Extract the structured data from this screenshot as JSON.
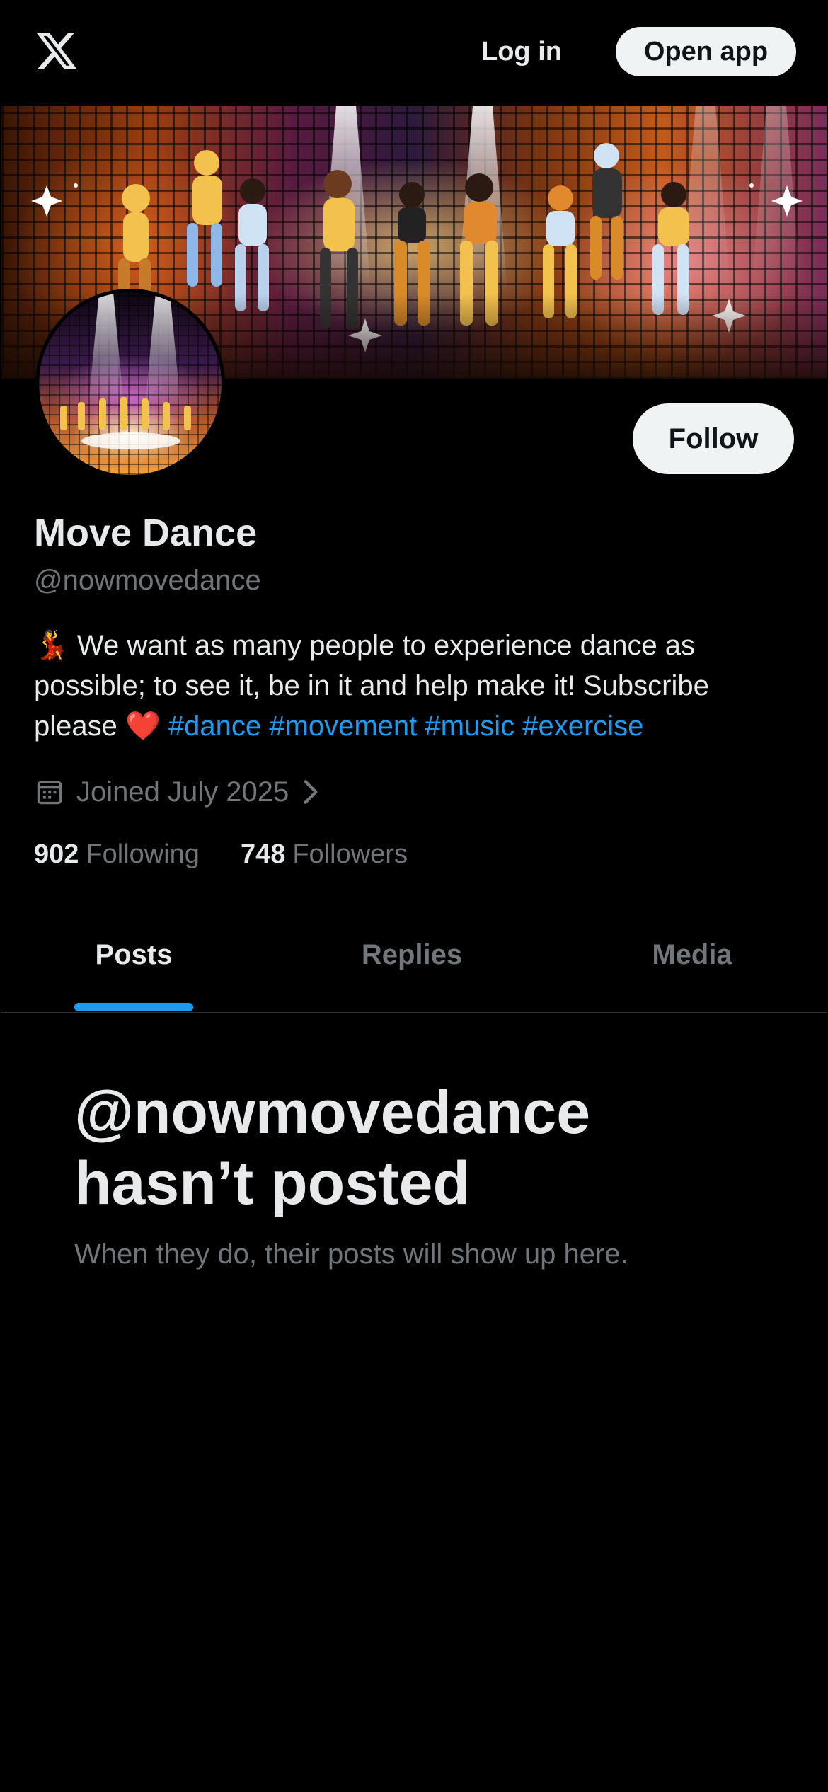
{
  "topbar": {
    "logo_icon": "x-logo-icon",
    "login_label": "Log in",
    "open_app_label": "Open app"
  },
  "profile": {
    "banner_icon": "dance-party-banner-image",
    "avatar_icon": "dance-stage-avatar-image",
    "follow_label": "Follow",
    "name": "Move Dance",
    "handle": "@nowmovedance",
    "bio": {
      "emoji_dancer": "💃",
      "text": " We want as many people to experience dance as possible; to see it, be in it and help make it! Subscribe please ",
      "emoji_heart": "❤️",
      "hashtags": [
        "#dance",
        "#movement",
        "#music",
        "#exercise"
      ]
    },
    "joined": {
      "icon": "calendar-icon",
      "label": "Joined July 2025",
      "chevron_icon": "chevron-right-icon"
    },
    "stats": {
      "following_count": "902",
      "following_label": "Following",
      "followers_count": "748",
      "followers_label": "Followers"
    }
  },
  "tabs": [
    {
      "label": "Posts",
      "active": true
    },
    {
      "label": "Replies",
      "active": false
    },
    {
      "label": "Media",
      "active": false
    }
  ],
  "empty_state": {
    "title": "@nowmovedance hasn’t posted",
    "subtitle": "When they do, their posts will show up here."
  },
  "colors": {
    "background": "#000000",
    "text_primary": "#e7e9ea",
    "text_secondary": "#71767b",
    "accent": "#1d9bf0",
    "button_bg": "#eff3f4"
  }
}
